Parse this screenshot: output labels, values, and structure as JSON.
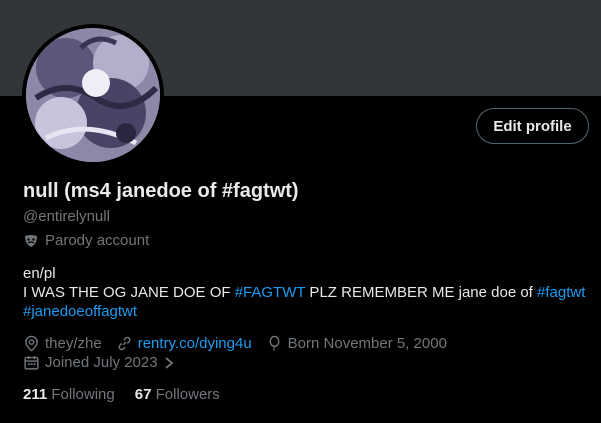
{
  "profile": {
    "display_name": "null (ms4 janedoe of #fagtwt)",
    "handle": "@entirelynull",
    "parody_label": "Parody account",
    "edit_button": "Edit profile"
  },
  "bio": {
    "line1": "en/pl",
    "line2_a": "I WAS THE OG JANE DOE OF ",
    "line2_tag1": "#FAGTWT",
    "line2_b": " PLZ REMEMBER ME jane doe of ",
    "line2_tag2": "#fagtwt",
    "line3_tag": "#janedoeoffagtwt"
  },
  "meta": {
    "location": "they/zhe",
    "website": "rentry.co/dying4u",
    "birthday": "Born November 5, 2000",
    "joined": "Joined July 2023"
  },
  "stats": {
    "following_count": "211",
    "following_label": "Following",
    "followers_count": "67",
    "followers_label": "Followers"
  },
  "icons": {
    "location": "location-pin-icon",
    "link": "link-icon",
    "birthday": "balloon-icon",
    "calendar": "calendar-icon",
    "parody": "mask-icon",
    "chevron": "chevron-right-icon"
  },
  "colors": {
    "background": "#000000",
    "banner": "#333639",
    "text": "#e7e9ea",
    "muted": "#71767b",
    "link": "#1d9bf0"
  }
}
